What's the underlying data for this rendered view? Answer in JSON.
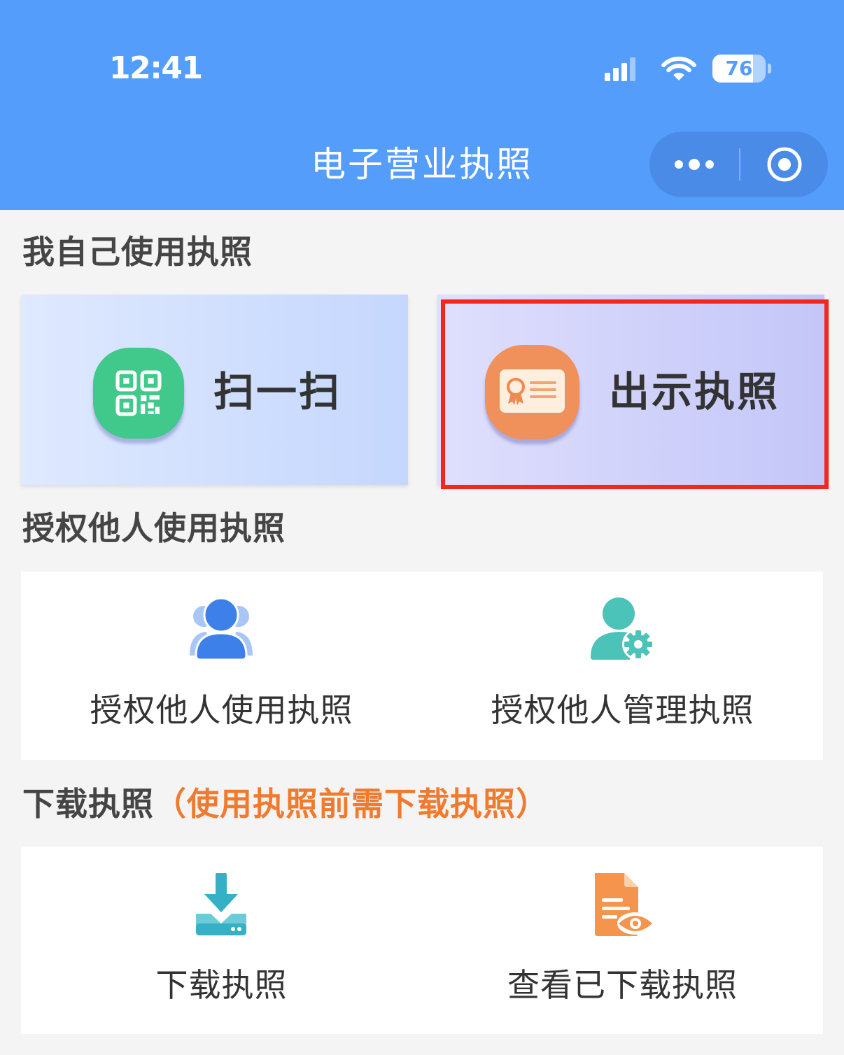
{
  "status_bar": {
    "time": "12:41",
    "battery": "76",
    "signal_icon": "cellular-signal-icon",
    "wifi_icon": "wifi-icon",
    "battery_icon": "battery-icon"
  },
  "header": {
    "title": "电子营业执照",
    "more_icon": "more-dots-icon",
    "close_icon": "target-circle-icon"
  },
  "self_use": {
    "heading": "我自己使用执照",
    "cards": [
      {
        "label": "扫一扫",
        "icon": "qr-code-icon",
        "highlighted": false
      },
      {
        "label": "出示执照",
        "icon": "license-card-icon",
        "highlighted": true
      }
    ]
  },
  "authorize": {
    "heading": "授权他人使用执照",
    "items": [
      {
        "label": "授权他人使用执照",
        "icon": "users-icon"
      },
      {
        "label": "授权他人管理执照",
        "icon": "user-settings-icon"
      }
    ]
  },
  "download": {
    "heading": "下载执照",
    "note": "（使用执照前需下载执照）",
    "items": [
      {
        "label": "下载执照",
        "icon": "download-icon"
      },
      {
        "label": "查看已下载执照",
        "icon": "view-document-icon"
      }
    ]
  },
  "colors": {
    "header_bg": "#549dfb",
    "capsule_bg": "#4a8be8",
    "page_bg": "#f4f4f4",
    "heading_text": "#454545",
    "note_text": "#f07a2e",
    "highlight_border": "#f5261b",
    "scan_card_start": "#dfe9ff",
    "scan_card_end": "#c5d7fd",
    "license_card_start": "#dfdffd",
    "license_card_end": "#c4c6f8",
    "scan_icon_bg": "#41c98b",
    "license_icon_bg": "#f0905a",
    "users_icon": "#3e80ea",
    "users_icon_light": "#a8c6f6",
    "manage_icon": "#4cc3b8",
    "download_icon": "#36b0c5",
    "download_icon_light": "#6ccbd8",
    "view_icon": "#f5944c"
  }
}
